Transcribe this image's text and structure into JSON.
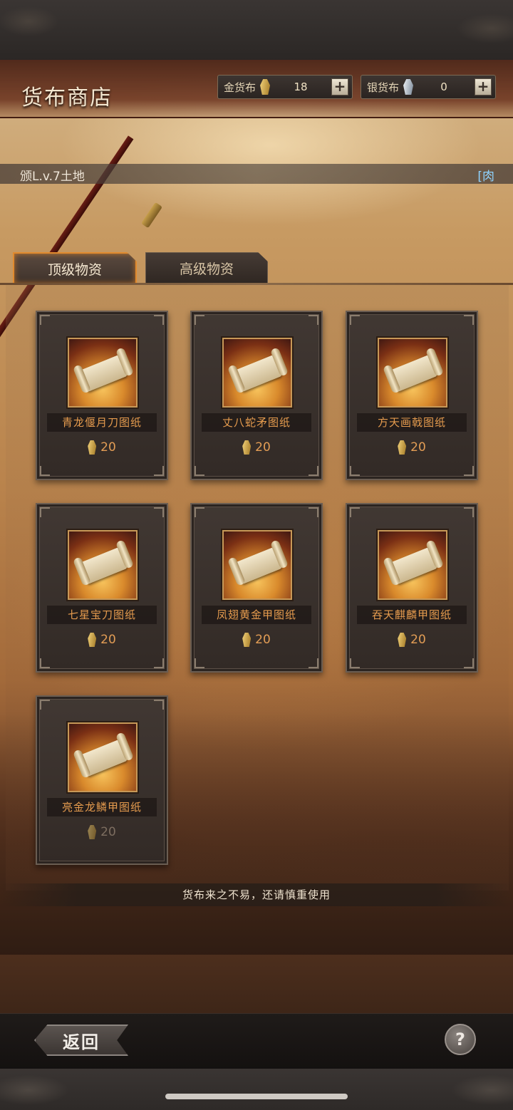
{
  "header": {
    "title": "货布商店",
    "gold": {
      "label": "金货布",
      "value": "18",
      "icon": "gold-coin-icon"
    },
    "silver": {
      "label": "银货布",
      "value": "0",
      "icon": "silver-coin-icon"
    },
    "plus_symbol": "+"
  },
  "marquee": {
    "left_text": "颁L.v.7土地",
    "right_text": "[肉"
  },
  "tabs": [
    {
      "label": "顶级物资",
      "active": true
    },
    {
      "label": "高级物资",
      "active": false
    }
  ],
  "items": [
    {
      "name": "青龙偃月刀图纸",
      "price": "20"
    },
    {
      "name": "丈八蛇矛图纸",
      "price": "20"
    },
    {
      "name": "方天画戟图纸",
      "price": "20"
    },
    {
      "name": "七星宝刀图纸",
      "price": "20"
    },
    {
      "name": "凤翅黄金甲图纸",
      "price": "20"
    },
    {
      "name": "吞天麒麟甲图纸",
      "price": "20"
    },
    {
      "name": "亮金龙鳞甲图纸",
      "price": "20"
    }
  ],
  "notice": "货布来之不易，还请慎重使用",
  "footer": {
    "back_label": "返回",
    "help_label": "?"
  },
  "colors": {
    "accent": "#e08a2e",
    "item_name": "#e59b4e",
    "price": "#e39d55"
  }
}
